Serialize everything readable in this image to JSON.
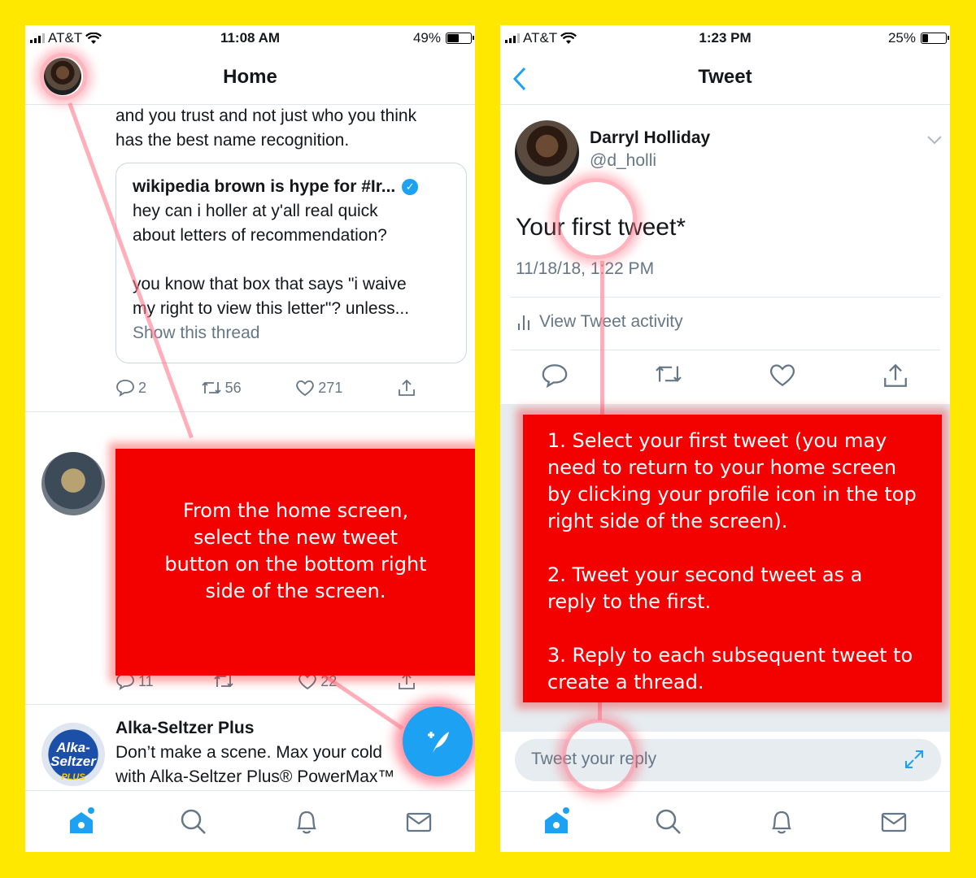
{
  "left": {
    "status": {
      "carrier": "AT&T",
      "time": "11:08 AM",
      "battery": "49%",
      "battery_level": 0.49
    },
    "title": "Home",
    "tweet1": {
      "text_line1": "and you trust and not just who you think",
      "text_line2": "has the best name recognition.",
      "quote": {
        "author": "wikipedia brown is hype for #Ir...",
        "line1": "hey can i holler at y'all real quick",
        "line2": "about letters of recommendation?",
        "line3": "you know that box that says \"i waive",
        "line4": "my right to view this letter\"? unless...",
        "link": "Show this thread"
      },
      "actions": {
        "replies": "2",
        "retweets": "56",
        "likes": "271"
      }
    },
    "tweet2": {
      "actions": {
        "replies": "11",
        "retweets": "",
        "likes": "22"
      }
    },
    "ad": {
      "logo_line1": "Alka-",
      "logo_line2": "Seltzer",
      "logo_line3": "PLUS",
      "name": "Alka-Seltzer Plus",
      "line1": "Don’t make a scene. Max your cold",
      "line2": "with Alka-Seltzer Plus® PowerMax™"
    },
    "tabs": [
      "home-icon",
      "search-icon",
      "bell-icon",
      "mail-icon"
    ],
    "instruction": "From the home screen, select the new tweet button on the bottom right side of the screen."
  },
  "right": {
    "status": {
      "carrier": "AT&T",
      "time": "1:23 PM",
      "battery": "25%",
      "battery_level": 0.25
    },
    "title": "Tweet",
    "tweet": {
      "name": "Darryl Holliday",
      "handle": "@d_holli",
      "body": "Your first tweet*",
      "date": "11/18/18, 1:22 PM",
      "activity": "View Tweet activity"
    },
    "reply_placeholder": "Tweet your reply",
    "tabs": [
      "home-icon",
      "search-icon",
      "bell-icon",
      "mail-icon"
    ],
    "instructions": {
      "step1": "1. Select your first tweet (you may need to return to your home screen by clicking your profile icon in the top right side of the screen).",
      "step2": "2. Tweet your second tweet as a reply to the first.",
      "step3": "3. Reply to each subsequent tweet to create a thread."
    }
  },
  "colors": {
    "background": "#FFE800",
    "twitter_blue": "#1DA1F2",
    "callout_red": "#F30000",
    "grey_text": "#657786"
  }
}
